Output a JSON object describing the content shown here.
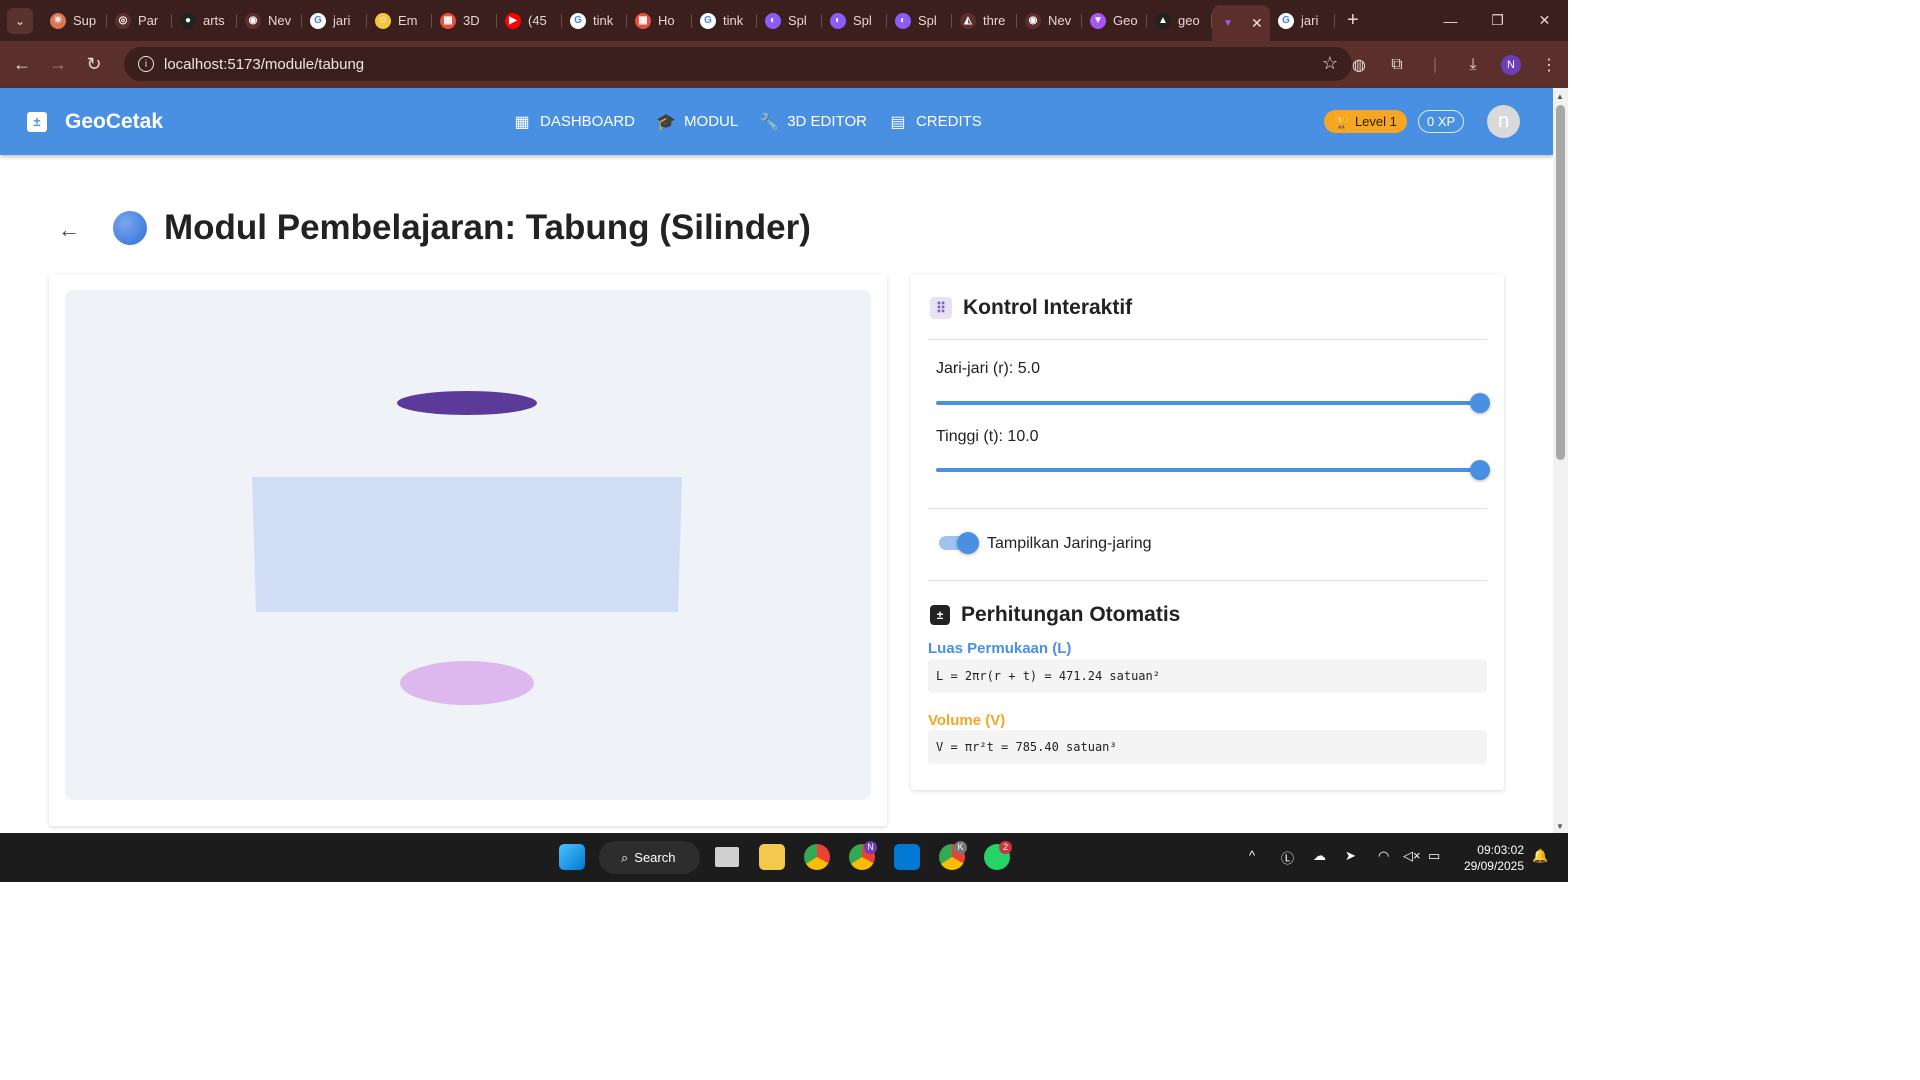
{
  "browser": {
    "tabs": [
      {
        "label": "Sup",
        "color": "#d97757",
        "glyph": "✳"
      },
      {
        "label": "Par",
        "color": "#5b2f2c",
        "glyph": "◎"
      },
      {
        "label": "arts",
        "color": "#222222",
        "glyph": "●"
      },
      {
        "label": "Nev",
        "color": "#5b2f2c",
        "glyph": "◉"
      },
      {
        "label": "jari",
        "color": "#ffffff",
        "glyph": "G"
      },
      {
        "label": "Em",
        "color": "#f5c542",
        "glyph": "☺"
      },
      {
        "label": "3D",
        "color": "#e94f3d",
        "glyph": "▦"
      },
      {
        "label": "(45",
        "color": "#ff0000",
        "glyph": "▶"
      },
      {
        "label": "tink",
        "color": "#ffffff",
        "glyph": "G"
      },
      {
        "label": "Ho",
        "color": "#e94f3d",
        "glyph": "▦"
      },
      {
        "label": "tink",
        "color": "#ffffff",
        "glyph": "G"
      },
      {
        "label": "Spl",
        "color": "#8b5cf6",
        "glyph": "◐"
      },
      {
        "label": "Spl",
        "color": "#8b5cf6",
        "glyph": "◐"
      },
      {
        "label": "Spl",
        "color": "#8b5cf6",
        "glyph": "◐"
      },
      {
        "label": "thre",
        "color": "#5b2f2c",
        "glyph": "◭"
      },
      {
        "label": "Nev",
        "color": "#5b2f2c",
        "glyph": "◉"
      },
      {
        "label": "Geo",
        "color": "#a855f7",
        "glyph": "▼"
      },
      {
        "label": "geo",
        "color": "#222222",
        "glyph": "▲"
      }
    ],
    "active_tab_icon": "vite-icon",
    "last_tab_label": "jari",
    "new_tab_label": "+",
    "url": "localhost:5173/module/tabung",
    "profile_initial": "N"
  },
  "app": {
    "name": "GeoCetak",
    "nav": [
      {
        "label": "DASHBOARD",
        "icon": "dashboard-icon",
        "glyph": "▦"
      },
      {
        "label": "MODUL",
        "icon": "school-icon",
        "glyph": "🎓"
      },
      {
        "label": "3D EDITOR",
        "icon": "wrench-icon",
        "glyph": "🔧"
      },
      {
        "label": "CREDITS",
        "icon": "document-icon",
        "glyph": "▤"
      }
    ],
    "level": "Level 1",
    "xp": "0 XP",
    "avatar_initial": "n"
  },
  "page": {
    "title": "Modul Pembelajaran: Tabung (Silinder)"
  },
  "viewer": {
    "colors": {
      "top_cap": "#5b3a9a",
      "lateral": "#d0ddf5",
      "bottom_cap": "#ddb8ef"
    }
  },
  "controls": {
    "heading": "Kontrol Interaktif",
    "radius_label": "Jari-jari (r): 5.0",
    "radius_value": 5.0,
    "radius_fraction": 1.0,
    "height_label": "Tinggi (t): 10.0",
    "height_value": 10.0,
    "height_fraction": 1.0,
    "toggle_label": "Tampilkan Jaring-jaring",
    "toggle_on": true
  },
  "calculations": {
    "heading": "Perhitungan Otomatis",
    "surface_label": "Luas Permukaan (L)",
    "surface_formula": "L = 2πr(r + t) = 471.24 satuan²",
    "surface_color": "#4a90e2",
    "volume_label": "Volume (V)",
    "volume_formula": "V = πr²t = 785.40 satuan³",
    "volume_color": "#f5a623"
  },
  "taskbar": {
    "search_label": "Search",
    "time": "09:03:02",
    "date": "29/09/2025",
    "badge_chrome": "N",
    "badge_chrome2": "K",
    "badge_whatsapp": "2"
  }
}
